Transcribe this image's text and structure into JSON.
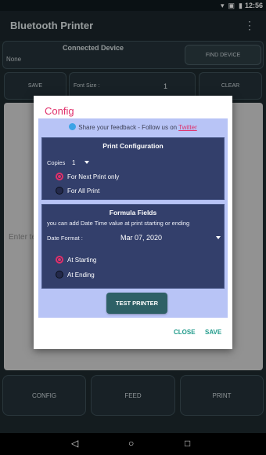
{
  "status_bar": {
    "time": "12:56",
    "icons": [
      "wifi-icon",
      "no-sim-icon",
      "battery-icon"
    ]
  },
  "app_bar": {
    "title": "Bluetooth Printer",
    "menu_icon": "overflow-menu-icon"
  },
  "connection": {
    "title": "Connected Device",
    "device": "None",
    "find_label": "FIND DEVICE"
  },
  "toolbar": {
    "save_label": "SAVE",
    "font_size_label": "Font Size :",
    "font_size_value": "1",
    "clear_label": "CLEAR"
  },
  "editor": {
    "placeholder": "Enter te"
  },
  "bottom_buttons": {
    "config": "CONFIG",
    "feed": "FEED",
    "print": "PRINT"
  },
  "nav_bar": {
    "back_icon": "back-icon",
    "home_icon": "home-icon",
    "recents_icon": "recents-icon"
  },
  "dialog": {
    "title": "Config",
    "feedback_text": "Share your feedback - Follow us on",
    "twitter_link": "Twitter",
    "print_config": {
      "title": "Print Configuration",
      "copies_label": "Copies",
      "copies_value": "1",
      "options": [
        {
          "label": "For Next Print only",
          "selected": true
        },
        {
          "label": "For All Print",
          "selected": false
        }
      ]
    },
    "formula": {
      "title": "Formula Fields",
      "description": "you can add Date Time value at print starting or ending",
      "date_format_label": "Date Format :",
      "date_format_value": "Mar 07, 2020",
      "options": [
        {
          "label": "At Starting",
          "selected": true
        },
        {
          "label": "At Ending",
          "selected": false
        }
      ]
    },
    "test_label": "TEST PRINTER",
    "close_label": "CLOSE",
    "save_label": "SAVE"
  },
  "colors": {
    "accent": "#e0306b",
    "action": "#1f9a8a",
    "section_bg": "#333f6b",
    "dialog_body": "#b8c4f6"
  }
}
